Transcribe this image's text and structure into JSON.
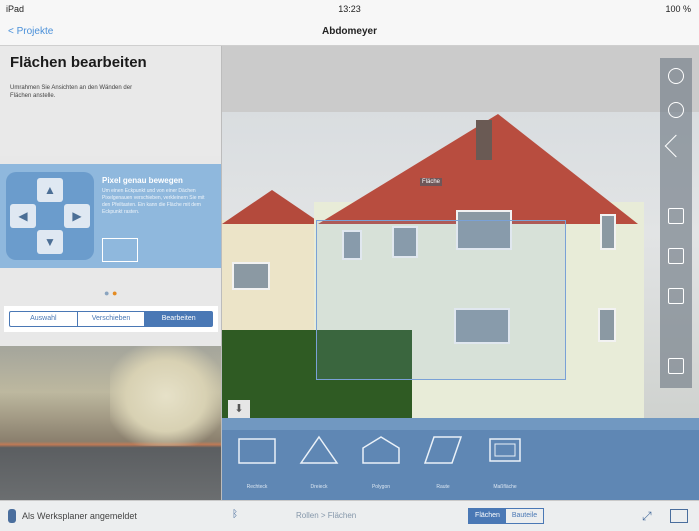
{
  "statusbar": {
    "left": "iPad",
    "time": "13:23",
    "right": "100 %"
  },
  "navbar": {
    "back_label": "< Projekte",
    "title": "Abdomeyer"
  },
  "panel": {
    "title": "Flächen bearbeiten",
    "description": "Umrahmen Sie Ansichten an den Wänden der Flächen anstelle.",
    "tip": {
      "title": "Pixel genau bewegen",
      "text": "Um einen Eckpunkt und von einer Dächen Pixelgenauen verschieben, verkleinern Sie mit den Pfeiltasten. Ein kann die Fläche mit dem Eckpunkt rasten."
    },
    "segments": [
      {
        "label": "Auswahl",
        "active": false
      },
      {
        "label": "Verschieben",
        "active": false
      },
      {
        "label": "Bearbeiten",
        "active": true
      }
    ]
  },
  "photo": {
    "selection_label": "Fläche"
  },
  "shapes": [
    {
      "label": "Rechteck",
      "icon": "rectangle-icon"
    },
    {
      "label": "Dreieck",
      "icon": "triangle-icon"
    },
    {
      "label": "Polygon",
      "icon": "pentagon-icon"
    },
    {
      "label": "Raute",
      "icon": "parallelogram-icon"
    },
    {
      "label": "Maßfläche",
      "icon": "measure-area-icon"
    }
  ],
  "footer": {
    "login_label": "Als Werksplaner angemeldet",
    "breadcrumb": "Rollen > Flächen",
    "toggle": [
      {
        "label": "Flächen",
        "active": true
      },
      {
        "label": "Bauteile",
        "active": false
      }
    ]
  },
  "colors": {
    "accent": "#4a78b5",
    "toolbar": "#5f87b4",
    "tip_bg": "#8fb8dd"
  }
}
